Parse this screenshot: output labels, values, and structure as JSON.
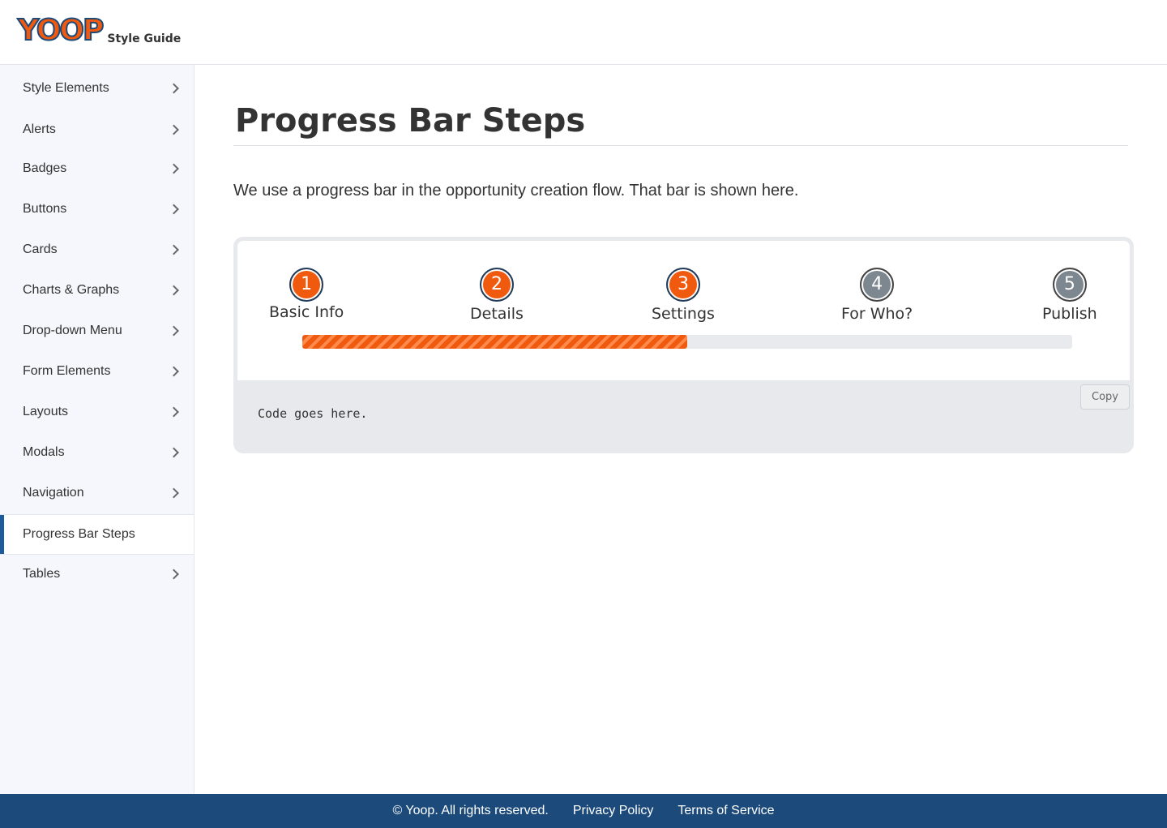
{
  "header": {
    "logo_text": "YOOP",
    "logo_subtitle": "Style Guide"
  },
  "sidebar": {
    "items": [
      {
        "label": "Style Elements",
        "active": false
      },
      {
        "label": "Alerts",
        "active": false
      },
      {
        "label": "Badges",
        "active": false
      },
      {
        "label": "Buttons",
        "active": false
      },
      {
        "label": "Cards",
        "active": false
      },
      {
        "label": "Charts & Graphs",
        "active": false
      },
      {
        "label": "Drop-down Menu",
        "active": false
      },
      {
        "label": "Form Elements",
        "active": false
      },
      {
        "label": "Layouts",
        "active": false
      },
      {
        "label": "Modals",
        "active": false
      },
      {
        "label": "Navigation",
        "active": false
      },
      {
        "label": "Progress Bar Steps",
        "active": true
      },
      {
        "label": "Tables",
        "active": false
      }
    ]
  },
  "main": {
    "title": "Progress Bar Steps",
    "intro": "We use a progress bar in the opportunity creation flow. That bar is shown here.",
    "progress": {
      "percent": 50,
      "steps": [
        {
          "number": "1",
          "label": "Basic Info",
          "status": "complete"
        },
        {
          "number": "2",
          "label": "Details",
          "status": "complete"
        },
        {
          "number": "3",
          "label": "Settings",
          "status": "complete"
        },
        {
          "number": "4",
          "label": "For Who?",
          "status": "incomplete"
        },
        {
          "number": "5",
          "label": "Publish",
          "status": "incomplete"
        }
      ]
    },
    "code": {
      "text": "Code goes here.",
      "copy_label": "Copy"
    }
  },
  "footer": {
    "copyright": "© Yoop. All rights reserved.",
    "privacy_label": "Privacy Policy",
    "terms_label": "Terms of Service"
  },
  "colors": {
    "accent": "#f05a0f",
    "brand_blue": "#1c4a7a",
    "step_incomplete": "#7d8790"
  },
  "icons": {
    "nav_chevron": "chevron-right-icon"
  }
}
